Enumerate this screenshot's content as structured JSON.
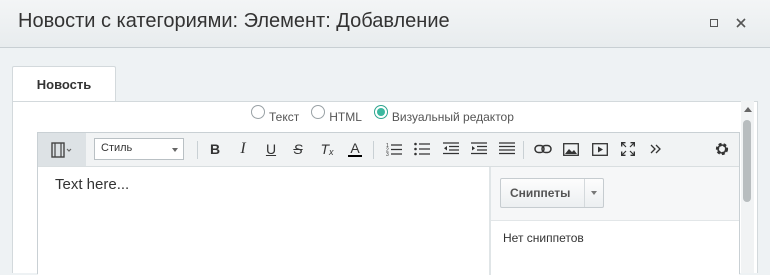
{
  "window": {
    "title": "Новости с категориями: Элемент: Добавление",
    "maximize_icon": "maximize-icon",
    "close_icon": "close-icon"
  },
  "tabs": [
    {
      "label": "Новость",
      "active": true
    }
  ],
  "editor_modes": [
    {
      "label": "Текст",
      "checked": false
    },
    {
      "label": "HTML",
      "checked": false
    },
    {
      "label": "Визуальный редактор",
      "checked": true
    }
  ],
  "toolbar": {
    "style_select_value": "Стиль",
    "buttons": [
      {
        "name": "bold",
        "glyph": "B"
      },
      {
        "name": "italic",
        "glyph": "I"
      },
      {
        "name": "underline",
        "glyph": "U"
      },
      {
        "name": "strikethrough",
        "glyph": "S"
      },
      {
        "name": "remove-format",
        "glyph": "T"
      },
      {
        "name": "font-color",
        "glyph": "A"
      }
    ],
    "icons": [
      "source-toggle-icon",
      "ordered-list-icon",
      "unordered-list-icon",
      "outdent-icon",
      "indent-icon",
      "align-icon",
      "link-icon",
      "image-icon",
      "video-icon",
      "fullscreen-icon",
      "more-icon",
      "settings-icon"
    ],
    "accent_color": "#3bb89f"
  },
  "editor": {
    "content": "Text here..."
  },
  "snippets": {
    "button_label": "Сниппеты",
    "empty_text": "Нет сниппетов"
  }
}
